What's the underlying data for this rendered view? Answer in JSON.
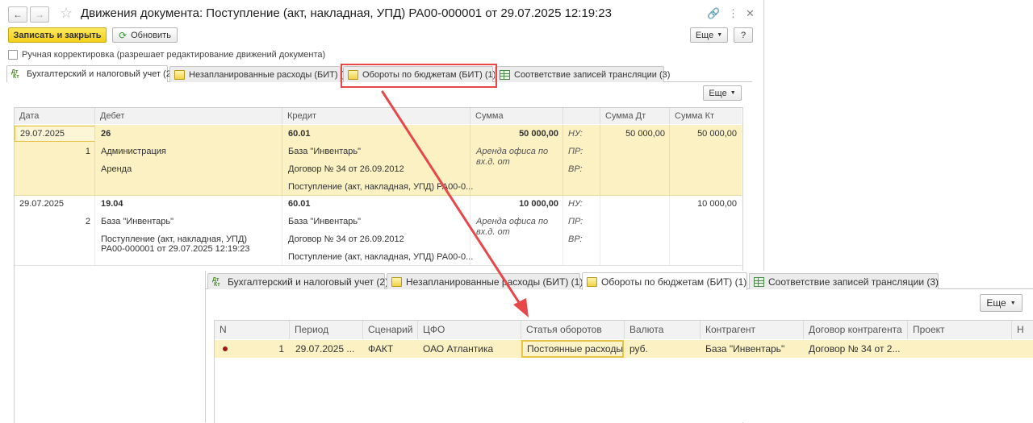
{
  "window": {
    "title": "Движения документа: Поступление (акт, накладная, УПД) РА00-000001 от 29.07.2025 12:19:23"
  },
  "toolbar": {
    "save_close": "Записать и закрыть",
    "refresh": "Обновить",
    "more": "Еще",
    "help": "?"
  },
  "manual_adjust": {
    "label": "Ручная корректировка (разрешает редактирование движений документа)",
    "checked": false
  },
  "tabs": [
    {
      "label": "Бухгалтерский и налоговый учет (2)",
      "icon": "dt-kt-icon"
    },
    {
      "label": "Незапланированные расходы (БИТ) (1)",
      "icon": "budget-register-icon"
    },
    {
      "label": "Обороты по бюджетам (БИТ) (1)",
      "icon": "budget-register-icon"
    },
    {
      "label": "Соответствие записей трансляции (3)",
      "icon": "table-grid-icon"
    }
  ],
  "grid_more": "Еще",
  "acc_table": {
    "headers": [
      "Дата",
      "Дебет",
      "Кредит",
      "Сумма",
      "",
      "Сумма Дт",
      "Сумма Кт"
    ],
    "rows": [
      {
        "date": "29.07.2025",
        "num": "1",
        "debit": [
          "26",
          "Администрация",
          "Аренда"
        ],
        "credit": [
          "60.01",
          "База \"Инвентарь\"",
          "Договор № 34 от 26.09.2012",
          "Поступление (акт, накладная, УПД) РА00-0..."
        ],
        "sum": "50 000,00",
        "content": "Аренда офиса по вх.д.  от",
        "types": [
          "НУ:",
          "ПР:",
          "ВР:"
        ],
        "sum_dt": "50 000,00",
        "sum_kt": "50 000,00"
      },
      {
        "date": "29.07.2025",
        "num": "2",
        "debit": [
          "19.04",
          "База \"Инвентарь\"",
          "Поступление (акт, накладная, УПД) РА00-000001 от 29.07.2025 12:19:23"
        ],
        "credit": [
          "60.01",
          "База \"Инвентарь\"",
          "Договор № 34 от 26.09.2012",
          "Поступление (акт, накладная, УПД) РА00-0..."
        ],
        "sum": "10 000,00",
        "content": "Аренда офиса по вх.д.  от",
        "types": [
          "НУ:",
          "ПР:",
          "ВР:"
        ],
        "sum_dt": "",
        "sum_kt": "10 000,00"
      }
    ]
  },
  "overlay": {
    "more": "Еще",
    "headers": [
      "N",
      "Период",
      "Сценарий",
      "ЦФО",
      "Статья оборотов",
      "Валюта",
      "Контрагент",
      "Договор контрагента",
      "Проект",
      "Н"
    ],
    "row": {
      "n": "1",
      "period": "29.07.2025 ...",
      "scenario": "ФАКТ",
      "cfo": "ОАО Атлантика",
      "article": "Постоянные расходы",
      "currency": "руб.",
      "counterparty": "База \"Инвентарь\"",
      "contract": "Договор № 34 от 2..."
    }
  },
  "colors": {
    "highlight_red": "#e8474a",
    "row_yellow": "#fbf1c3",
    "primary_button": "#f3cf1b"
  }
}
